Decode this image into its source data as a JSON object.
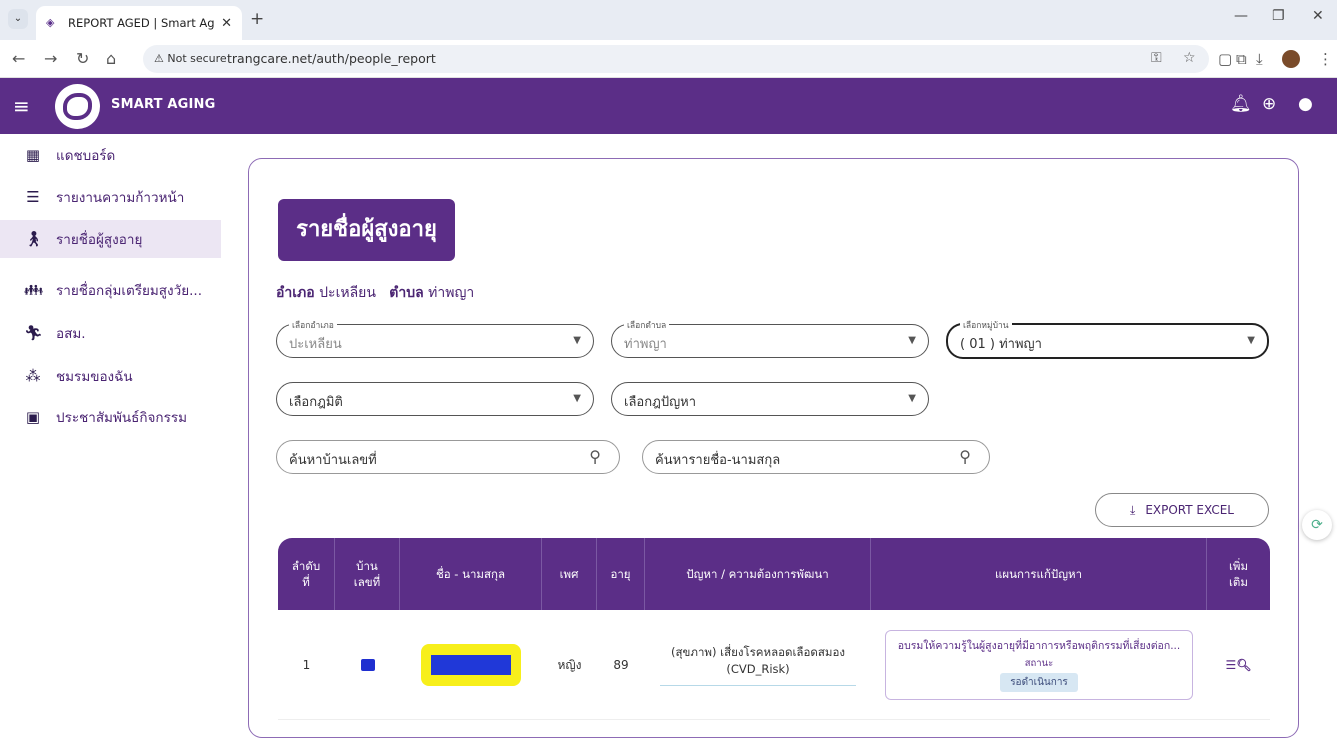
{
  "browser": {
    "tab_title": "REPORT AGED | Smart Ageing",
    "url_security": "Not secure",
    "url": "trangcare.net/auth/people_report"
  },
  "header": {
    "brand": "SMART AGING"
  },
  "sidebar": {
    "items": [
      {
        "label": "แดชบอร์ด",
        "icon": "dashboard-icon"
      },
      {
        "label": "รายงานความก้าวหน้า",
        "icon": "list-icon"
      },
      {
        "label": "รายชื่อผู้สูงอายุ",
        "icon": "elderly-icon"
      },
      {
        "label": "รายชื่อกลุ่มเตรียมสูงวัย...",
        "icon": "family-icon"
      },
      {
        "label": "อสม.",
        "icon": "walking-icon"
      },
      {
        "label": "ชมรมของฉัน",
        "icon": "group-icon"
      },
      {
        "label": "ประชาสัมพันธ์กิจกรรม",
        "icon": "photo-icon"
      }
    ]
  },
  "main": {
    "title": "รายชื่อผู้สูงอายุ",
    "location": {
      "district_label": "อำเภอ",
      "district_value": "ปะเหลียน",
      "subdistrict_label": "ตำบล",
      "subdistrict_value": "ท่าพญา"
    },
    "filters": {
      "district": {
        "legend": "เลือกอำเภอ",
        "value": "ปะเหลียน"
      },
      "subdistrict": {
        "legend": "เลือกตำบล",
        "value": "ท่าพญา"
      },
      "village": {
        "legend": "เลือกหมู่บ้าน",
        "value": "( 01 ) ท่าพญา"
      },
      "status": {
        "value": "เลือกฎมิติ"
      },
      "problem": {
        "value": "เลือกฎปัญหา"
      }
    },
    "search": {
      "house_placeholder": "ค้นหาบ้านเลขที่",
      "name_placeholder": "ค้นหารายชื่อ-นามสกุล"
    },
    "export_label": "EXPORT EXCEL",
    "table": {
      "headers": {
        "no": "ลำดับ\nที่",
        "house": "บ้าน\nเลขที่",
        "name": "ชื่อ - นามสกุล",
        "sex": "เพศ",
        "age": "อายุ",
        "problem": "ปัญหา / ความต้องการพัฒนา",
        "plan": "แผนการแก้ปัญหา",
        "more": "เพิ่ม\nเติม"
      },
      "rows": [
        {
          "no": "1",
          "sex": "หญิง",
          "age": "89",
          "problem": "(สุขภาพ) เสี่ยงโรคหลอดเลือดสมอง (CVD_Risk)",
          "plan": "อบรมให้ความรู้ในผู้สูงอายุที่มีอาการหรือพฤติกรรมที่เสี่ยงต่อก...",
          "status_label": "สถานะ",
          "status_value": "รอดำเนินการ",
          "more": "☰🔍"
        }
      ]
    }
  }
}
